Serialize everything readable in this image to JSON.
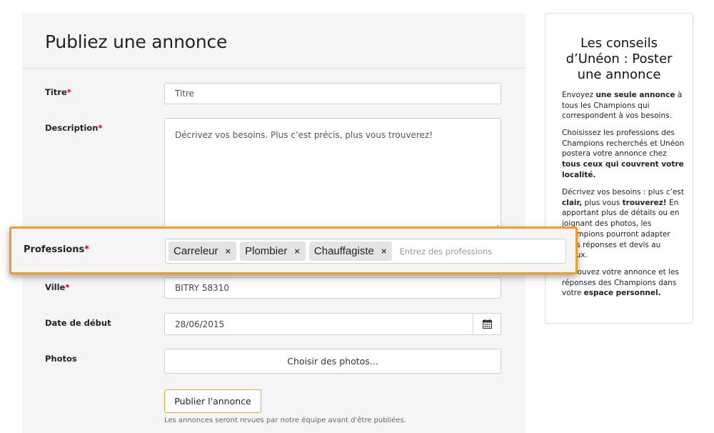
{
  "form": {
    "title": "Publiez une annonce",
    "required_mark": "*",
    "titre": {
      "label": "Titre",
      "placeholder": "Titre"
    },
    "description": {
      "label": "Description",
      "placeholder": "Décrivez vos besoins. Plus c’est précis, plus vous trouverez!"
    },
    "professions": {
      "label": "Professions",
      "tags": [
        "Carreleur",
        "Plombier",
        "Chauffagiste"
      ],
      "remove_glyph": "×",
      "placeholder": "Entrez des professions"
    },
    "ville": {
      "label": "Ville",
      "value": "BITRY 58310"
    },
    "date": {
      "label": "Date de début",
      "value": "28/06/2015"
    },
    "photos": {
      "label": "Photos",
      "button": "Choisir des photos..."
    },
    "submit": "Publier l'annonce",
    "note": "Les annonces seront revues par notre équipe avant d'être publiées."
  },
  "sidebar": {
    "title": "Les conseils d’Unéon : Poster une annonce",
    "p1": {
      "a": "Envoyez ",
      "b": "une seule annonce",
      "c": " à tous les Champions qui correspondent à vos besoins."
    },
    "p2": {
      "a": "Choisissez les professions des Champions recherchés et Unéon postera votre annonce chez ",
      "b": "tous ceux qui couvrent votre localité."
    },
    "p3": {
      "a": "Décrivez vos besoins : plus c’est ",
      "b": "clair,",
      "c": " plus vous ",
      "d": "trouverez!",
      "e": " En apportant plus de détails ou en joignant des photos, les Champions pourront adapter leurs réponses et devis au mieux."
    },
    "p4": {
      "a": "Retrouvez votre annonce et les réponses des Champions dans votre ",
      "b": "espace personnel."
    }
  },
  "icons": {
    "calendar": "calendar-icon",
    "remove": "close-icon",
    "resize": "resize-grip-icon"
  },
  "colors": {
    "highlight": "#f39a2b",
    "required": "#d0021b",
    "submit_border": "#e6a23c"
  }
}
